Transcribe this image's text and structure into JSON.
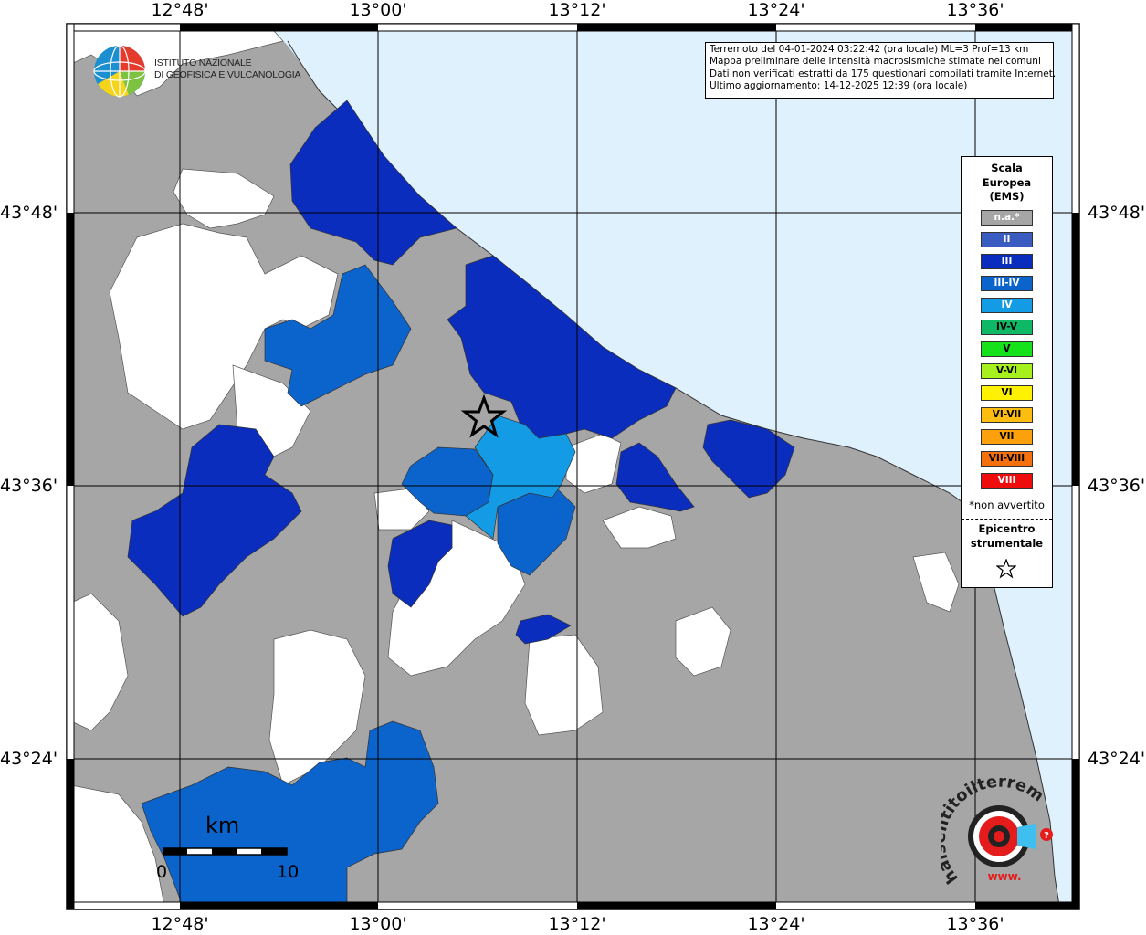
{
  "ticks": {
    "lon": [
      "12°48'",
      "13°00'",
      "13°12'",
      "13°24'",
      "13°36'"
    ],
    "lat": [
      "43°48'",
      "43°36'",
      "43°24'"
    ]
  },
  "info": {
    "line1": "Terremoto del 04-01-2024 03:22:42 (ora locale) ML=3 Prof=13 km",
    "line2": "Mappa preliminare delle intensità macrosismiche stimate nei comuni",
    "line3": "Dati non verificati estratti da 175 questionari compilati tramite Internet.",
    "line4": "Ultimo aggiornamento: 14-12-2025 12:39 (ora locale)"
  },
  "institute": {
    "line1": "ISTITUTO NAZIONALE",
    "line2": "DI GEOFISICA E VULCANOLOGIA"
  },
  "legend": {
    "title1": "Scala",
    "title2": "Europea",
    "title3": "(EMS)",
    "items": [
      {
        "label": "n.a.*",
        "color": "#a6a6a6",
        "text_color": "#ffffff"
      },
      {
        "label": "II",
        "color": "#3a5cc0",
        "text_color": "#ffffff"
      },
      {
        "label": "III",
        "color": "#0a2dbd",
        "text_color": "#ffffff"
      },
      {
        "label": "III-IV",
        "color": "#0b63cc",
        "text_color": "#ffffff"
      },
      {
        "label": "IV",
        "color": "#139be6",
        "text_color": "#ffffff"
      },
      {
        "label": "IV-V",
        "color": "#0fb865",
        "text_color": "#000000"
      },
      {
        "label": "V",
        "color": "#16e21b",
        "text_color": "#000000"
      },
      {
        "label": "V-VI",
        "color": "#a6f01d",
        "text_color": "#000000"
      },
      {
        "label": "VI",
        "color": "#fff200",
        "text_color": "#000000"
      },
      {
        "label": "VI-VII",
        "color": "#fdbd10",
        "text_color": "#000000"
      },
      {
        "label": "VII",
        "color": "#fca10c",
        "text_color": "#000000"
      },
      {
        "label": "VII-VIII",
        "color": "#f7700e",
        "text_color": "#000000"
      },
      {
        "label": "VIII",
        "color": "#ef0c0c",
        "text_color": "#ffffff"
      }
    ],
    "note": "*non avvertito",
    "epicenter1": "Epicentro",
    "epicenter2": "strumentale"
  },
  "scale": {
    "title": "km",
    "start": "0",
    "end": "10"
  },
  "colors": {
    "sea": "#dff1fd",
    "no_data": "#a6a6a6",
    "ems_iii": "#0a2dbd",
    "ems_iii_iv": "#0b63cc",
    "ems_iv": "#139be6",
    "unaffected": "#ffffff"
  },
  "watermark": {
    "text": "haisentitoilterremoto.it",
    "url_text": "www."
  }
}
